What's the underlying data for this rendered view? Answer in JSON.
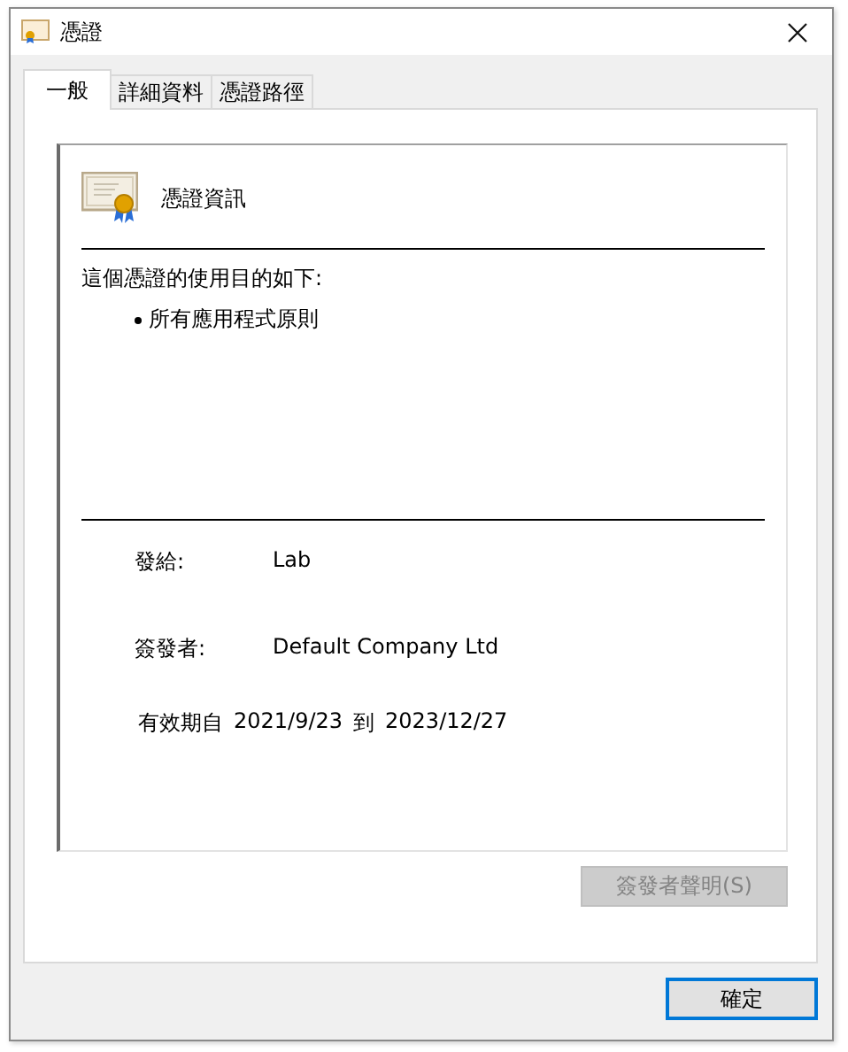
{
  "window": {
    "title": "憑證"
  },
  "tabs": [
    {
      "label": "一般",
      "selected": true
    },
    {
      "label": "詳細資料",
      "selected": false
    },
    {
      "label": "憑證路徑",
      "selected": false
    }
  ],
  "certificate": {
    "heading": "憑證資訊",
    "purpose_intro": "這個憑證的使用目的如下:",
    "purposes": [
      "所有應用程式原則"
    ],
    "fields": [
      {
        "label": "發給:",
        "value": "Lab"
      },
      {
        "label": "簽發者:",
        "value": "Default Company Ltd"
      }
    ],
    "validity": {
      "from_label": "有效期自",
      "from": "2021/9/23",
      "to_label": "到",
      "to": "2023/12/27"
    }
  },
  "issuer_statement_button": {
    "label": "簽發者聲明(S)",
    "disabled": true
  },
  "ok_button": {
    "label": "確定"
  }
}
